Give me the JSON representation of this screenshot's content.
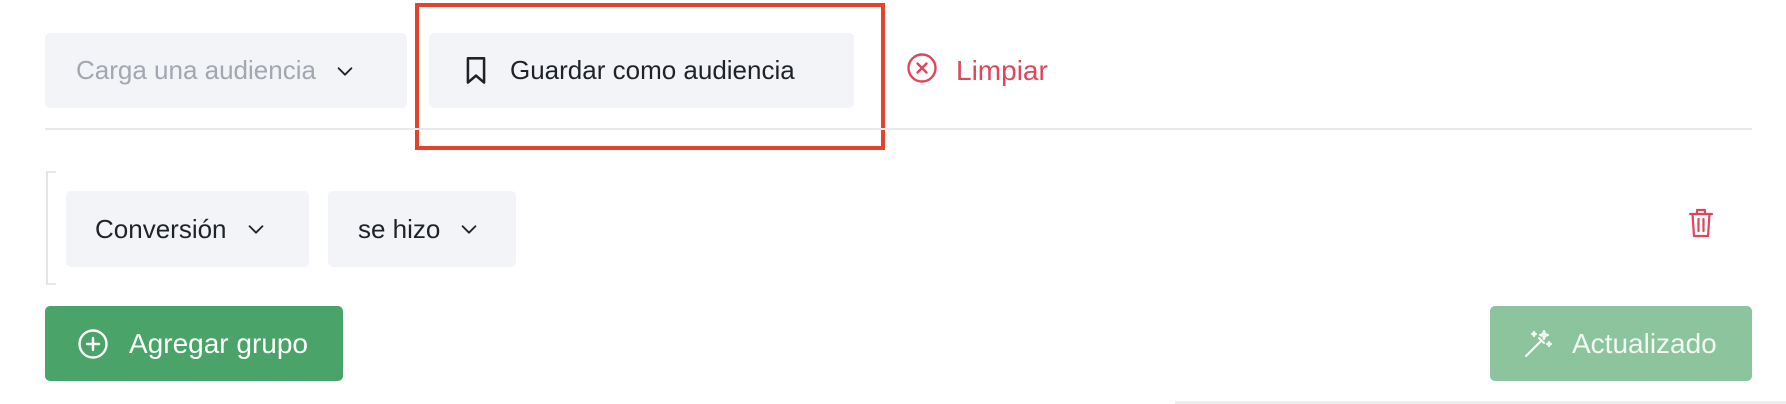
{
  "toolbar": {
    "load_audience_label": "Carga una audiencia",
    "save_audience_label": "Guardar como audiencia",
    "clear_label": "Limpiar"
  },
  "filter": {
    "field_label": "Conversión",
    "operator_label": "se hizo"
  },
  "actions": {
    "add_group_label": "Agregar grupo",
    "status_label": "Actualizado"
  },
  "icons": {
    "load_audience": "chevron-down-icon",
    "save_audience": "bookmark-icon",
    "clear": "close-circle-icon",
    "field_dropdown": "chevron-down-icon",
    "operator_dropdown": "chevron-down-icon",
    "delete_group": "trash-icon",
    "add_group": "plus-circle-icon",
    "status": "magic-wand-icon"
  },
  "colors": {
    "chip_background": "#f3f4f7",
    "highlight": "#e3432c",
    "danger": "#e0455a",
    "primary_green": "#4aa368",
    "disabled_green": "#8cc49e",
    "placeholder_text": "#a2a7b0",
    "text": "#1f2328"
  }
}
